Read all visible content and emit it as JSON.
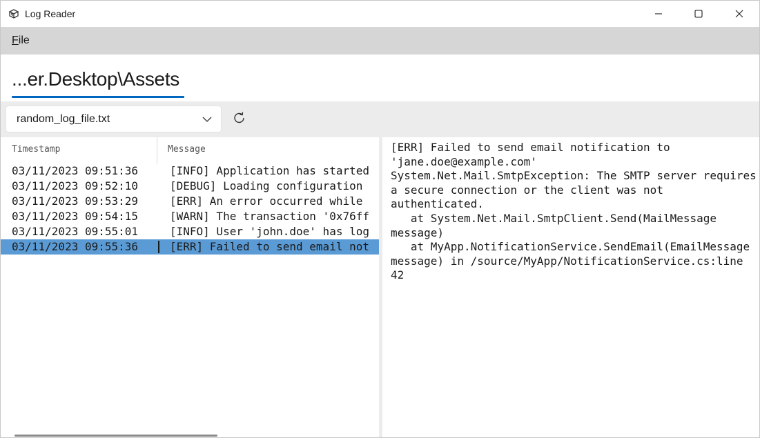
{
  "window": {
    "title": "Log Reader",
    "icon": "log-reader-app-icon"
  },
  "menu": {
    "file_label_underlined": "F",
    "file_label_rest": "ile"
  },
  "header": {
    "path": "...er.Desktop\\Assets"
  },
  "toolbar": {
    "selected_file": "random_log_file.txt",
    "refresh_icon": "refresh-icon",
    "dropdown_icon": "chevron-down-icon"
  },
  "table": {
    "columns": [
      "Timestamp",
      "Message"
    ],
    "rows": [
      {
        "timestamp": "03/11/2023 09:51:36",
        "message": "[INFO] Application has started"
      },
      {
        "timestamp": "03/11/2023 09:52:10",
        "message": "[DEBUG] Loading configuration"
      },
      {
        "timestamp": "03/11/2023 09:53:29",
        "message": "[ERR] An error occurred while"
      },
      {
        "timestamp": "03/11/2023 09:54:15",
        "message": "[WARN] The transaction '0x76ff"
      },
      {
        "timestamp": "03/11/2023 09:55:01",
        "message": "[INFO] User 'john.doe' has log"
      },
      {
        "timestamp": "03/11/2023 09:55:36",
        "message": "[ERR] Failed to send email not",
        "selected": true
      }
    ]
  },
  "detail": {
    "text": "[ERR] Failed to send email notification to 'jane.doe@example.com'\nSystem.Net.Mail.SmtpException: The SMTP server requires a secure connection or the client was not authenticated.\n   at System.Net.Mail.SmtpClient.Send(MailMessage message)\n   at MyApp.NotificationService.SendEmail(EmailMessage message) in /source/MyApp/NotificationService.cs:line 42"
  },
  "colors": {
    "accent": "#0067c0",
    "selection": "#5b9bd5",
    "menubar": "#d6d6d6",
    "toolbar": "#ececec"
  }
}
